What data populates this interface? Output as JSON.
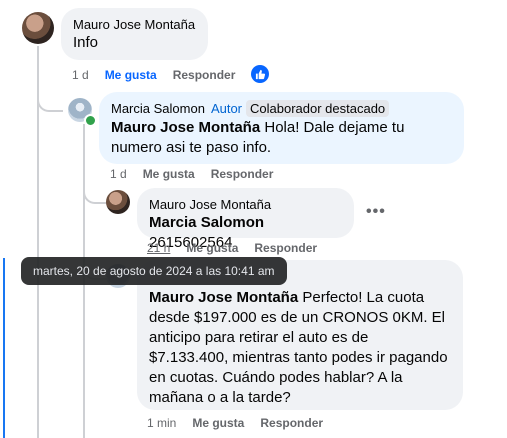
{
  "comment1": {
    "author": "Mauro Jose Montaña",
    "text": "Info",
    "time": "1 d",
    "like_label": "Me gusta",
    "reply_label": "Responder"
  },
  "comment2": {
    "author": "Marcia Salomon",
    "author_badge": "Autor",
    "colab_badge": "Colaborador destacado",
    "mention": "Mauro Jose Montaña",
    "text": " Hola! Dale dejame tu numero asi te paso info.",
    "time": "1 d",
    "like_label": "Me gusta",
    "reply_label": "Responder"
  },
  "comment3": {
    "author": "Mauro Jose Montaña",
    "mention": "Marcia Salomon",
    "text": " 2615602564",
    "time": "21 h",
    "like_label": "Me gusta",
    "reply_label": "Responder",
    "more_label": "•••"
  },
  "comment4": {
    "mention": "Mauro Jose Montaña",
    "text": " Perfecto! La cuota desde $197.000 es de un CRONOS 0KM. El anticipo para retirar el auto es de $7.133.400, mientras tanto podes ir pagando en cuotas. Cuándo podes hablar? A la mañana o a la tarde?",
    "time": "1 min",
    "like_label": "Me gusta",
    "reply_label": "Responder"
  },
  "tooltip": {
    "text": "martes, 20 de agosto de 2024 a las 10:41 am"
  },
  "colors": {
    "accent": "#0866ff",
    "bubble_gray": "#f0f2f5",
    "bubble_blue": "#ebf5ff",
    "meta_gray": "#65676b"
  }
}
